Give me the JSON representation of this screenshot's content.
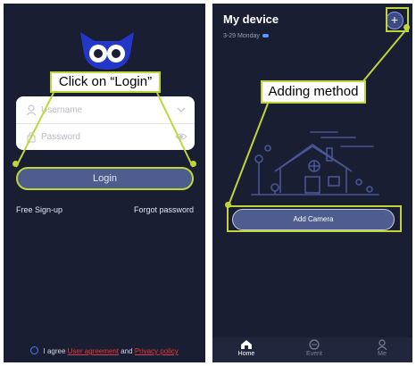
{
  "left_screen": {
    "username_placeholder": "Username",
    "password_placeholder": "Password",
    "login_label": "Login",
    "signup_label": "Free Sign-up",
    "forgot_label": "Forgot password",
    "agree_prefix": "I agree",
    "user_agreement": "User agreement",
    "and_text": "and",
    "privacy_policy": "Privacy policy"
  },
  "right_screen": {
    "title": "My device",
    "date": "3-29 Monday",
    "add_camera_label": "Add Camera",
    "tabs": [
      {
        "label": "Home",
        "icon": "home-icon",
        "active": true
      },
      {
        "label": "Event",
        "icon": "chat-icon",
        "active": false
      },
      {
        "label": "Me",
        "icon": "person-icon",
        "active": false
      }
    ]
  },
  "annotations": {
    "click_login": "Click on “Login”",
    "adding_method": "Adding method",
    "highlight_color": "#bfd63a"
  },
  "colors": {
    "background": "#1a1e33",
    "button": "#4f5c8e",
    "link_red": "#e03c3c"
  }
}
